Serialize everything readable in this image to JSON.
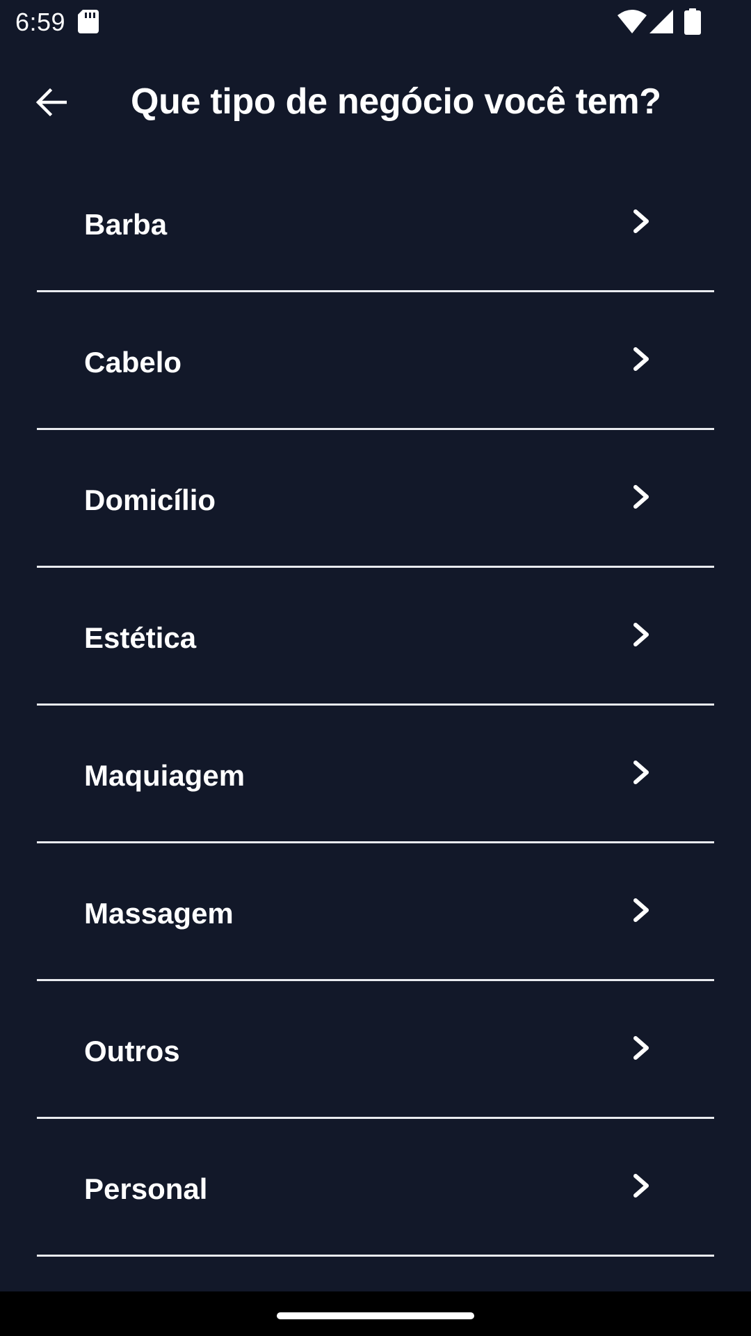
{
  "status_bar": {
    "time": "6:59",
    "icons": [
      "sd-card-icon",
      "wifi-icon",
      "signal-icon",
      "battery-icon"
    ]
  },
  "app_bar": {
    "back_icon": "arrow-back-icon",
    "title": "Que tipo de negócio você tem?"
  },
  "categories": {
    "items": [
      {
        "label": "Barba"
      },
      {
        "label": "Cabelo"
      },
      {
        "label": "Domicílio"
      },
      {
        "label": "Estética"
      },
      {
        "label": "Maquiagem"
      },
      {
        "label": "Massagem"
      },
      {
        "label": "Outros"
      },
      {
        "label": "Personal"
      }
    ],
    "item_icon": "chevron-right-icon"
  },
  "colors": {
    "background": "#121829",
    "text": "#ffffff",
    "divider": "#e9ebef",
    "nav_bar": "#000000"
  }
}
